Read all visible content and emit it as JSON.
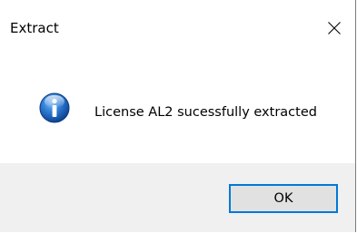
{
  "dialog": {
    "title": "Extract",
    "message": "License AL2 sucessfully extracted",
    "icon": "info-icon",
    "ok_label": "OK"
  },
  "colors": {
    "footer_bg": "#f0f0f0",
    "button_bg": "#e1e1e1",
    "button_focus_border": "#0078d7",
    "icon_blue": "#1c5fb0"
  }
}
